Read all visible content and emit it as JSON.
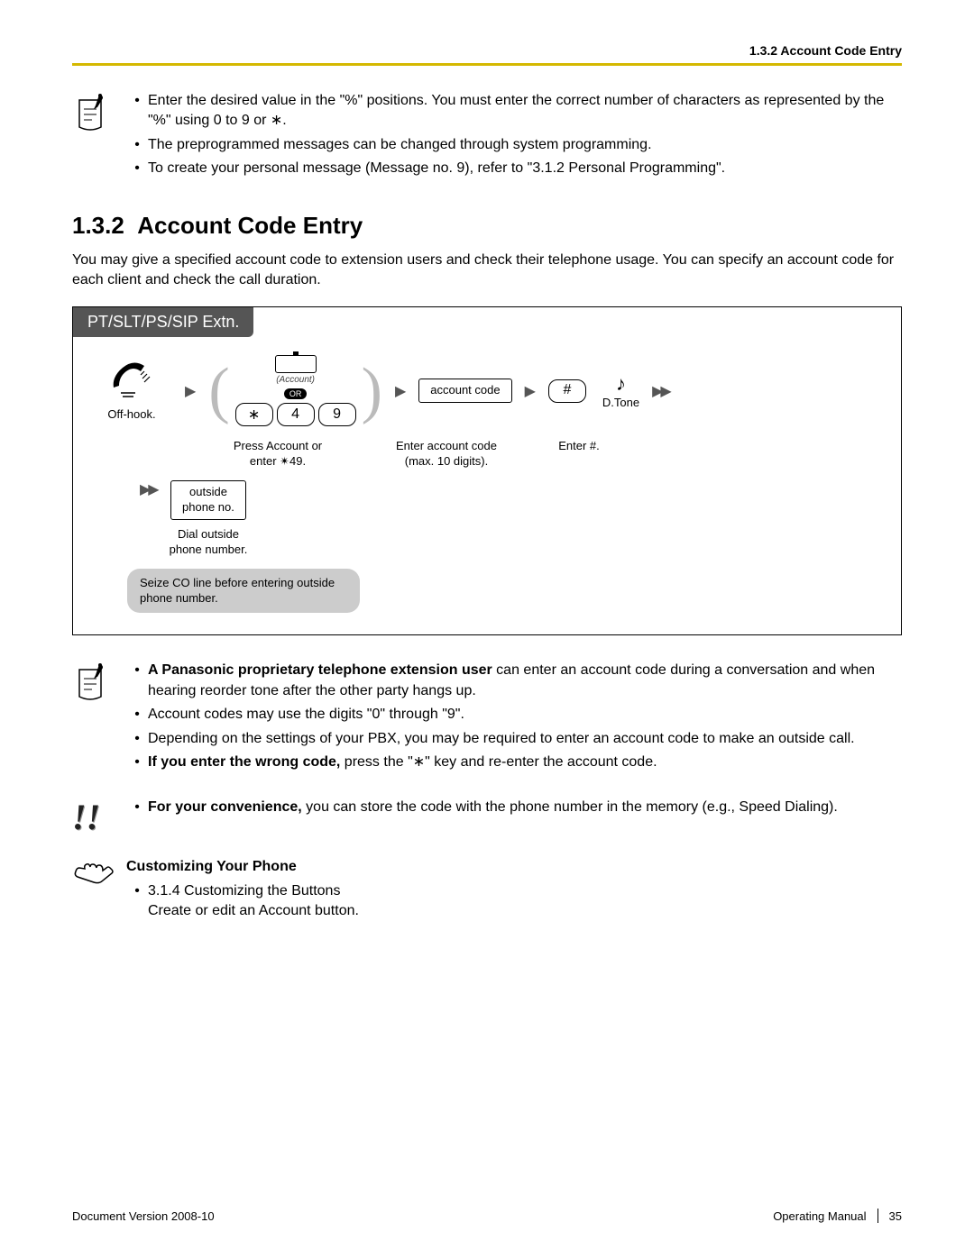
{
  "header": {
    "breadcrumb": "1.3.2 Account Code Entry"
  },
  "topNote": {
    "b1": "Enter the desired value in the \"%\" positions. You must enter the correct number of characters as represented by the \"%\" using 0 to 9 or ∗.",
    "b2": "The preprogrammed messages can be changed through system programming.",
    "b3": "To create your personal message (Message no. 9), refer to \"3.1.2  Personal Programming\"."
  },
  "section": {
    "number": "1.3.2",
    "title": "Account Code Entry",
    "intro": "You may give a specified account code to extension users and check their telephone usage. You can specify an account code for each client and check the call duration."
  },
  "procedure": {
    "tab": "PT/SLT/PS/SIP Extn.",
    "accountLabel": "(Account)",
    "or": "OR",
    "keys": {
      "star": "∗",
      "k4": "4",
      "k9": "9",
      "hash": "#"
    },
    "captions": {
      "offhook": "Off-hook.",
      "pressAccount1": "Press Account or",
      "pressAccount2": "enter ✴49.",
      "enterCode1": "Enter account code",
      "enterCode2": "(max. 10 digits).",
      "enterHash": "Enter #.",
      "dialOutside1": "Dial outside",
      "dialOutside2": "phone number."
    },
    "accountCodeBox": "account code",
    "outsideBox1": "outside",
    "outsideBox2": "phone no.",
    "dtone": "D.Tone",
    "callout": "Seize CO line before entering outside phone number."
  },
  "notes2": {
    "b1_bold": "A Panasonic proprietary telephone extension user",
    "b1_rest": " can enter an account code during a conversation and when hearing reorder tone after the other party hangs up.",
    "b2": "Account codes may use the digits \"0\" through \"9\".",
    "b3": "Depending on the settings of your PBX, you may be required to enter an account code to make an outside call.",
    "b4_bold": "If you enter the wrong code,",
    "b4_rest": " press the \"∗\" key and re-enter the account code."
  },
  "tip": {
    "b1_bold": "For your convenience,",
    "b1_rest": " you can store the code with the phone number in the memory (e.g., Speed Dialing)."
  },
  "custom": {
    "heading": "Customizing Your Phone",
    "b1_line1": "3.1.4  Customizing the Buttons",
    "b1_line2": "Create or edit an Account button."
  },
  "footer": {
    "left": "Document Version  2008-10",
    "manual": "Operating Manual",
    "page": "35"
  }
}
